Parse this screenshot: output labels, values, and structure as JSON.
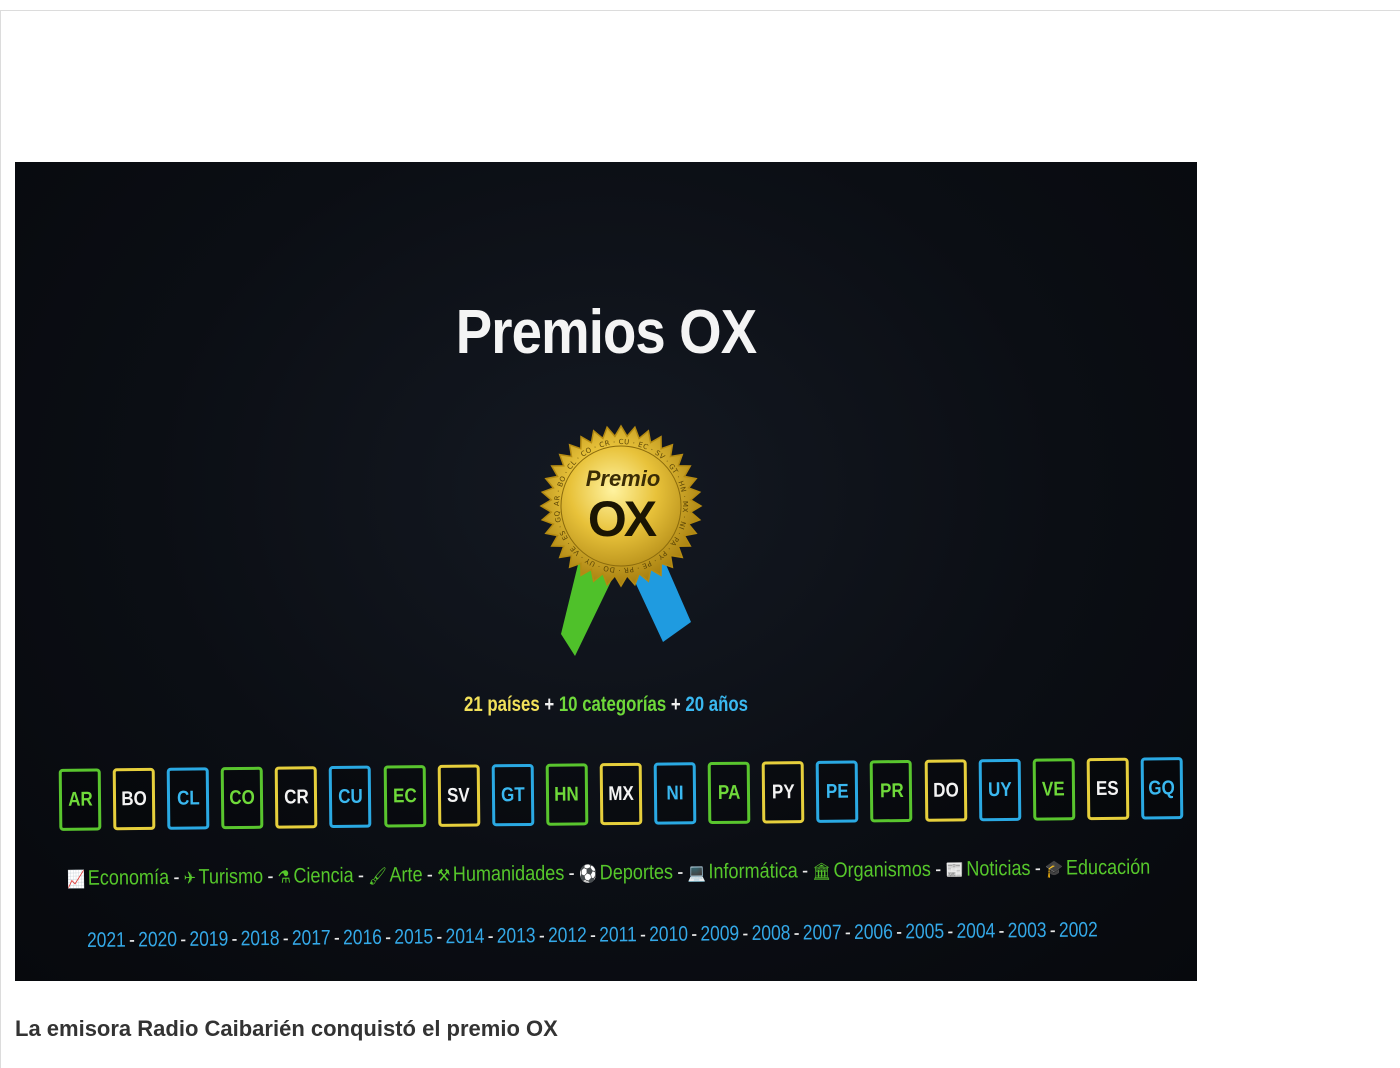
{
  "image": {
    "title": "Premios OX",
    "seal": {
      "top_text": "Premio",
      "main_text": "OX",
      "ring_text": "AR · BO · CL · CO · CR · CU · EC · SV · GT · HN · MX · NI · PA · PY · PE · PR · DO · UY · VE · ES · GQ"
    },
    "tagline": {
      "part1": "21 países",
      "plus1": "+",
      "part2": "10 categorías",
      "plus2": "+",
      "part3": "20 años"
    },
    "country_codes": [
      {
        "code": "AR",
        "color": "green"
      },
      {
        "code": "BO",
        "color": "yellow"
      },
      {
        "code": "CL",
        "color": "blue"
      },
      {
        "code": "CO",
        "color": "green"
      },
      {
        "code": "CR",
        "color": "yellow"
      },
      {
        "code": "CU",
        "color": "blue"
      },
      {
        "code": "EC",
        "color": "green"
      },
      {
        "code": "SV",
        "color": "yellow"
      },
      {
        "code": "GT",
        "color": "blue"
      },
      {
        "code": "HN",
        "color": "green"
      },
      {
        "code": "MX",
        "color": "yellow"
      },
      {
        "code": "NI",
        "color": "blue"
      },
      {
        "code": "PA",
        "color": "green"
      },
      {
        "code": "PY",
        "color": "yellow"
      },
      {
        "code": "PE",
        "color": "blue"
      },
      {
        "code": "PR",
        "color": "green"
      },
      {
        "code": "DO",
        "color": "yellow"
      },
      {
        "code": "UY",
        "color": "blue"
      },
      {
        "code": "VE",
        "color": "green"
      },
      {
        "code": "ES",
        "color": "yellow"
      },
      {
        "code": "GQ",
        "color": "blue"
      }
    ],
    "categories": [
      {
        "label": "Economía",
        "icon": "chart-icon",
        "glyph": "📈"
      },
      {
        "label": "Turismo",
        "icon": "plane-icon",
        "glyph": "✈"
      },
      {
        "label": "Ciencia",
        "icon": "flask-icon",
        "glyph": "⚗"
      },
      {
        "label": "Arte",
        "icon": "brush-icon",
        "glyph": "🖌"
      },
      {
        "label": "Humanidades",
        "icon": "gavel-icon",
        "glyph": "⚒"
      },
      {
        "label": "Deportes",
        "icon": "ball-icon",
        "glyph": "⚽"
      },
      {
        "label": "Informática",
        "icon": "laptop-icon",
        "glyph": "💻"
      },
      {
        "label": "Organismos",
        "icon": "building-icon",
        "glyph": "🏛"
      },
      {
        "label": "Noticias",
        "icon": "newspaper-icon",
        "glyph": "📰"
      },
      {
        "label": "Educación",
        "icon": "graduation-cap-icon",
        "glyph": "🎓"
      }
    ],
    "years": [
      "2021",
      "2020",
      "2019",
      "2018",
      "2017",
      "2016",
      "2015",
      "2014",
      "2013",
      "2012",
      "2011",
      "2010",
      "2009",
      "2008",
      "2007",
      "2006",
      "2005",
      "2004",
      "2003",
      "2002"
    ],
    "separator": "-"
  },
  "caption": "La emisora Radio Caibarién conquistó el premio OX",
  "colors": {
    "green": "#6fd93a",
    "yellow": "#e6cf3c",
    "blue": "#3ab8f0",
    "gold": "#d9b52a",
    "background": "#0b0e14"
  }
}
